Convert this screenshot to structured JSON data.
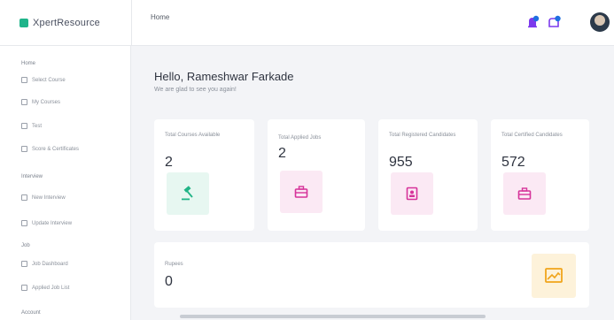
{
  "brand": {
    "name": "XpertResource",
    "color": "#1fb48a"
  },
  "breadcrumb": "Home",
  "header": {
    "icons": [
      "notification-bell-icon",
      "message-bell-icon"
    ],
    "accent": "#7c3aed",
    "dot": "#1e6fe0"
  },
  "sidebar": {
    "sections": [
      {
        "title": "Home",
        "items": [
          "Select Course",
          "My Courses",
          "Test",
          "Score & Certificates"
        ]
      },
      {
        "title": "Interview",
        "items": [
          "New Interview",
          "Update Interview"
        ]
      },
      {
        "title": "Job",
        "items": [
          "Job Dashboard",
          "Applied Job List"
        ]
      },
      {
        "title": "Account",
        "items": []
      }
    ]
  },
  "main": {
    "greeting": "Hello, Rameshwar Farkade",
    "subgreeting": "We are glad to see you again!",
    "cards": [
      {
        "label": "Total Courses Available",
        "value": "2",
        "icon": "gavel-icon",
        "tint": "#e7f7f1",
        "color": "#20b486"
      },
      {
        "label": "Total Applied Jobs",
        "value": "2",
        "icon": "briefcase-icon",
        "tint": "#fbe9f4",
        "color": "#d6339a"
      },
      {
        "label": "Total Registered Candidates",
        "value": "955",
        "icon": "id-card-icon",
        "tint": "#fbe9f4",
        "color": "#d6339a"
      },
      {
        "label": "Total Certified Candidates",
        "value": "572",
        "icon": "briefcase-icon",
        "tint": "#fbe9f4",
        "color": "#d6339a"
      }
    ],
    "wide_card": {
      "label": "Rupees",
      "value": "0",
      "icon": "image-icon",
      "tint": "#fdf2da",
      "color": "#f0a41b"
    }
  }
}
